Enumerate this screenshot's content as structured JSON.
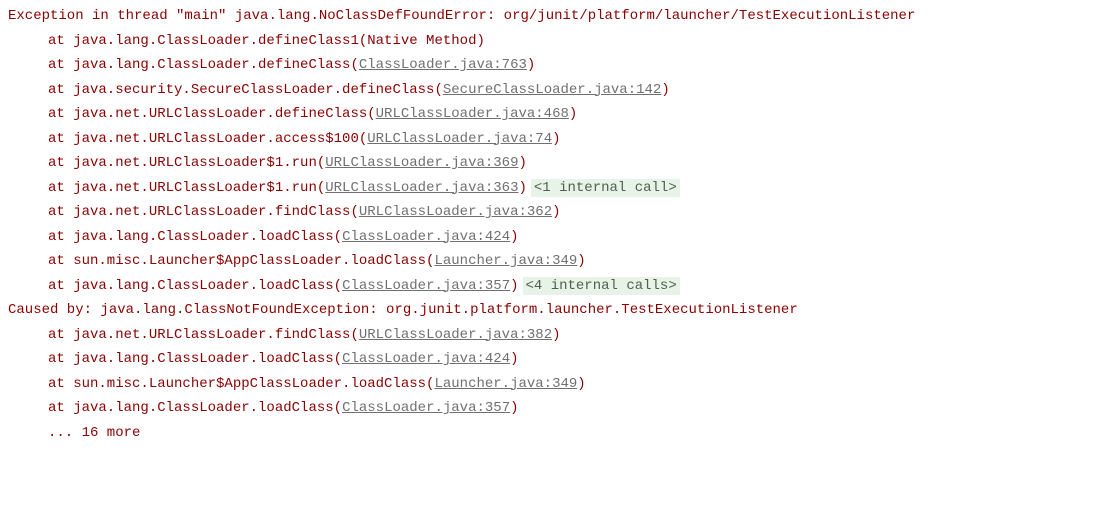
{
  "stacktrace": {
    "header": "Exception in thread \"main\" java.lang.NoClassDefFoundError: org/junit/platform/launcher/TestExecutionListener",
    "frames": [
      {
        "text": "at java.lang.ClassLoader.defineClass1(Native Method)",
        "link": null,
        "fold": null
      },
      {
        "text": "at java.lang.ClassLoader.defineClass(",
        "link": "ClassLoader.java:763",
        "fold": null
      },
      {
        "text": "at java.security.SecureClassLoader.defineClass(",
        "link": "SecureClassLoader.java:142",
        "fold": null
      },
      {
        "text": "at java.net.URLClassLoader.defineClass(",
        "link": "URLClassLoader.java:468",
        "fold": null
      },
      {
        "text": "at java.net.URLClassLoader.access$100(",
        "link": "URLClassLoader.java:74",
        "fold": null
      },
      {
        "text": "at java.net.URLClassLoader$1.run(",
        "link": "URLClassLoader.java:369",
        "fold": null
      },
      {
        "text": "at java.net.URLClassLoader$1.run(",
        "link": "URLClassLoader.java:363",
        "fold": "<1 internal call>"
      },
      {
        "text": "at java.net.URLClassLoader.findClass(",
        "link": "URLClassLoader.java:362",
        "fold": null
      },
      {
        "text": "at java.lang.ClassLoader.loadClass(",
        "link": "ClassLoader.java:424",
        "fold": null
      },
      {
        "text": "at sun.misc.Launcher$AppClassLoader.loadClass(",
        "link": "Launcher.java:349",
        "fold": null
      },
      {
        "text": "at java.lang.ClassLoader.loadClass(",
        "link": "ClassLoader.java:357",
        "fold": "<4 internal calls>"
      }
    ],
    "caused_by": "Caused by: java.lang.ClassNotFoundException: org.junit.platform.launcher.TestExecutionListener",
    "caused_frames": [
      {
        "text": "at java.net.URLClassLoader.findClass(",
        "link": "URLClassLoader.java:382",
        "fold": null
      },
      {
        "text": "at java.lang.ClassLoader.loadClass(",
        "link": "ClassLoader.java:424",
        "fold": null
      },
      {
        "text": "at sun.misc.Launcher$AppClassLoader.loadClass(",
        "link": "Launcher.java:349",
        "fold": null
      },
      {
        "text": "at java.lang.ClassLoader.loadClass(",
        "link": "ClassLoader.java:357",
        "fold": null
      }
    ],
    "more": "... 16 more",
    "close_paren": ")"
  }
}
